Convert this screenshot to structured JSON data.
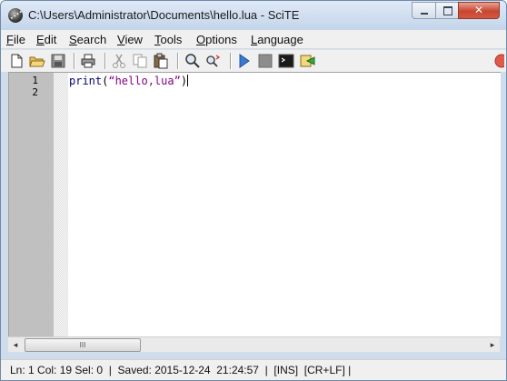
{
  "window": {
    "title": "C:\\Users\\Administrator\\Documents\\hello.lua - SciTE",
    "close_glyph": "✕"
  },
  "menubar": {
    "items": [
      {
        "key": "F",
        "rest": "ile"
      },
      {
        "key": "E",
        "rest": "dit"
      },
      {
        "key": "S",
        "rest": "earch"
      },
      {
        "key": "V",
        "rest": "iew"
      },
      {
        "key": "T",
        "rest": "ools"
      },
      {
        "key": "O",
        "rest": "ptions"
      },
      {
        "key": "L",
        "rest": "anguage"
      }
    ]
  },
  "toolbar": {
    "icons": [
      "new-file-icon",
      "open-folder-icon",
      "save-disk-icon",
      "print-icon",
      "cut-icon",
      "copy-icon",
      "paste-icon",
      "find-icon",
      "replace-icon",
      "run-icon",
      "stop-icon",
      "console-icon",
      "build-icon",
      "close-icon"
    ]
  },
  "editor": {
    "line_numbers": [
      "1",
      "2"
    ],
    "code": {
      "fn": "print",
      "paren_open": "(",
      "string": "“hello,lua”",
      "paren_close": ")"
    },
    "colors": {
      "keyword": "#00007f",
      "string": "#7f007f",
      "margin": "#c0c0c0"
    }
  },
  "scrollbar": {
    "left_arrow": "◂",
    "right_arrow": "▸",
    "thumb_grip": "III"
  },
  "statusbar": {
    "text": "Ln: 1 Col: 19 Sel: 0  |  Saved: 2015-12-24  21:24:57  |  [INS]  [CR+LF] |"
  }
}
